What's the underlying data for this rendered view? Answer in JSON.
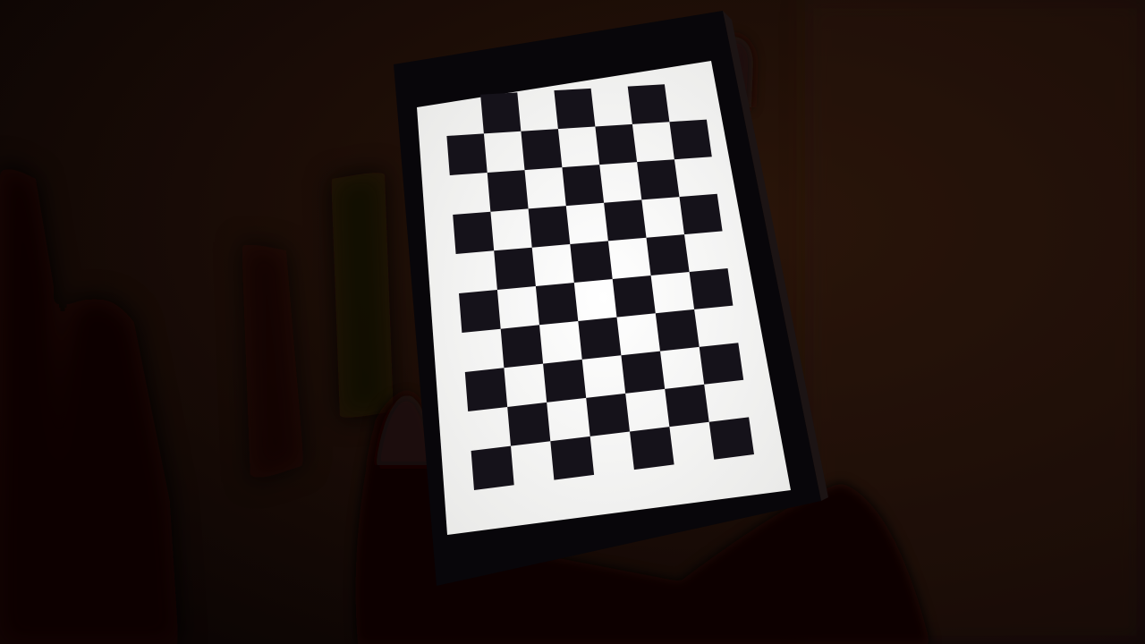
{
  "scene": {
    "subject": "tablet-displaying-checkerboard",
    "screen_color": "#f4f4f2",
    "square_color": "#15121a",
    "bezel_color": "#08060a",
    "wall_color": "#1a0d07",
    "checkerboard": {
      "rows": 10,
      "cols": 7,
      "pattern": "alternating"
    }
  }
}
